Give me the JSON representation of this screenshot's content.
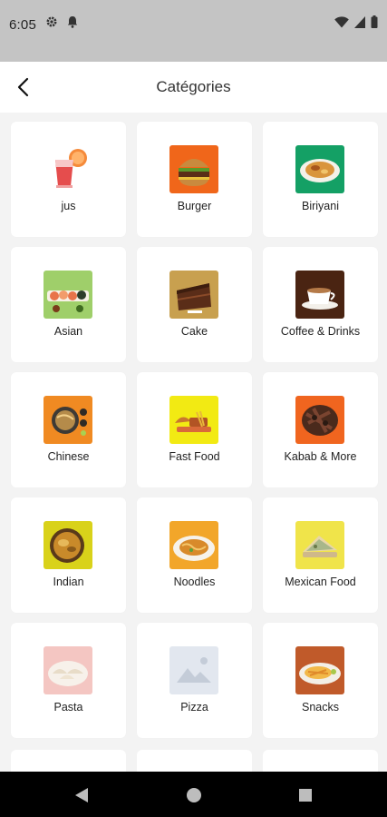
{
  "status_bar": {
    "time": "6:05"
  },
  "app_bar": {
    "title": "Catégories"
  },
  "categories": [
    {
      "label": "jus",
      "icon": "juice-drink-icon"
    },
    {
      "label": "Burger",
      "icon": "burger-icon"
    },
    {
      "label": "Biriyani",
      "icon": "biriyani-plate-icon"
    },
    {
      "label": "Asian",
      "icon": "sushi-icon"
    },
    {
      "label": "Cake",
      "icon": "cake-slice-icon"
    },
    {
      "label": "Coffee & Drinks",
      "icon": "coffee-cup-icon"
    },
    {
      "label": "Chinese",
      "icon": "chinese-bowl-icon"
    },
    {
      "label": "Fast Food",
      "icon": "fast-food-icon"
    },
    {
      "label": "Kabab & More",
      "icon": "kabab-icon"
    },
    {
      "label": "Indian",
      "icon": "indian-curry-icon"
    },
    {
      "label": "Noodles",
      "icon": "noodles-plate-icon"
    },
    {
      "label": "Mexican Food",
      "icon": "mexican-food-icon"
    },
    {
      "label": "Pasta",
      "icon": "pasta-dumplings-icon"
    },
    {
      "label": "Pizza",
      "icon": "image-placeholder-icon"
    },
    {
      "label": "Snacks",
      "icon": "snacks-plate-icon"
    }
  ],
  "colors": {
    "status_bar": "#c4c4c4",
    "app_bar": "#ffffff",
    "background": "#f3f3f3",
    "nav_bar": "#000000"
  }
}
